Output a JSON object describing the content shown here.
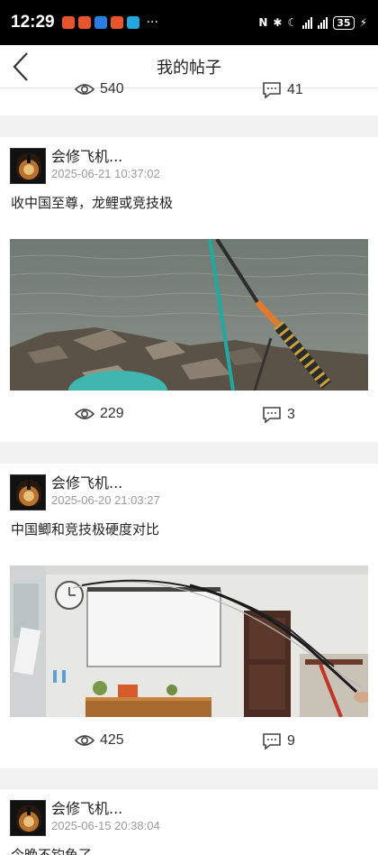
{
  "status_bar": {
    "time": "12:29",
    "more": "···",
    "battery": "35"
  },
  "header": {
    "title": "我的帖子",
    "back_icon": "chevron-left-icon"
  },
  "partial_post": {
    "views": "540",
    "comments": "41"
  },
  "posts": [
    {
      "author": "会修飞机...",
      "time": "2025-06-21 10:37:02",
      "text": "收中国至尊，龙鲤或竞技极",
      "views": "229",
      "comments": "3",
      "image_icon": "fishing-rods-by-water-photo"
    },
    {
      "author": "会修飞机...",
      "time": "2025-06-20 21:03:27",
      "text": "中国鲫和竞技极硬度对比",
      "views": "425",
      "comments": "9",
      "image_icon": "rods-bending-in-room-photo"
    },
    {
      "author": "会修飞机...",
      "time": "2025-06-15 20:38:04",
      "text": "今晚不钓鱼了"
    }
  ]
}
